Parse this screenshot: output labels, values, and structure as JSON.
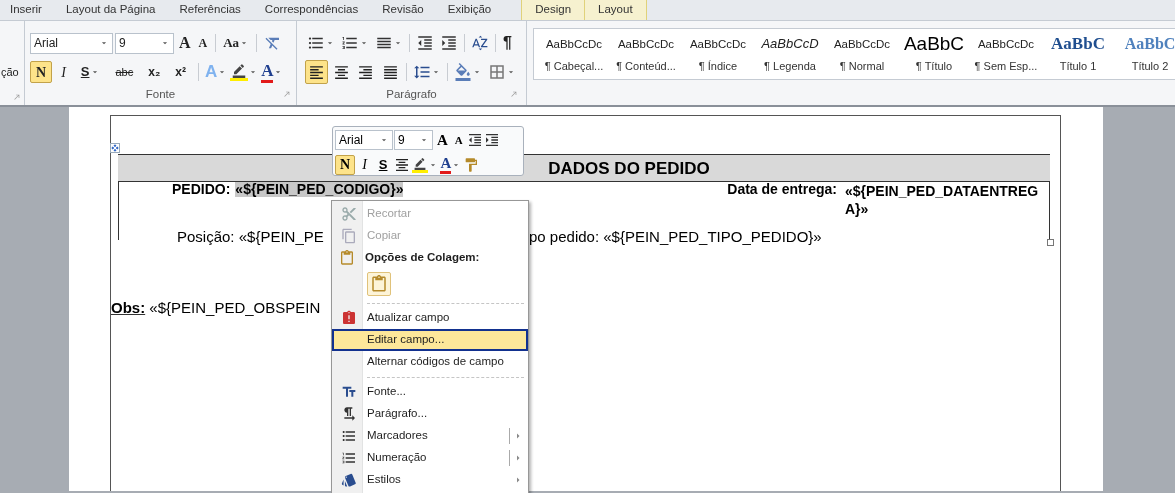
{
  "tabs": [
    {
      "label": "Inserir",
      "kind": "normal"
    },
    {
      "label": "Layout da Página",
      "kind": "normal"
    },
    {
      "label": "Referências",
      "kind": "normal"
    },
    {
      "label": "Correspondências",
      "kind": "normal"
    },
    {
      "label": "Revisão",
      "kind": "normal"
    },
    {
      "label": "Exibição",
      "kind": "normal"
    },
    {
      "label": "Design",
      "kind": "contextual"
    },
    {
      "label": "Layout",
      "kind": "contextual"
    }
  ],
  "ribbon": {
    "clipped_group_text": "ção",
    "font_group": {
      "label": "Fonte",
      "font_name": "Arial",
      "font_size": "9",
      "grow": "A",
      "shrink": "A",
      "change_case": "Aa",
      "format_buttons": [
        {
          "glyph": "N",
          "kind": "bold",
          "selected": true,
          "dropdown": false
        },
        {
          "glyph": "I",
          "kind": "italic",
          "selected": false,
          "dropdown": false
        },
        {
          "glyph": "S",
          "kind": "underline",
          "selected": false,
          "dropdown": true
        },
        {
          "glyph": "abc",
          "kind": "strike",
          "selected": false,
          "dropdown": false
        },
        {
          "glyph": "x₂",
          "kind": "sub",
          "selected": false,
          "dropdown": false
        },
        {
          "glyph": "x²",
          "kind": "sup",
          "selected": false,
          "dropdown": false
        }
      ],
      "effects": "A",
      "font_color": "A"
    },
    "paragraph_group": {
      "label": "Parágrafo",
      "pilcrow": "¶",
      "align_buttons": [
        {
          "kind": "left",
          "selected": true
        },
        {
          "kind": "center",
          "selected": false
        },
        {
          "kind": "right",
          "selected": false
        },
        {
          "kind": "justify",
          "selected": false
        }
      ]
    },
    "styles": [
      {
        "sample": "AaBbCcDc",
        "label": "¶ Cabeçal...",
        "kind": "plain"
      },
      {
        "sample": "AaBbCcDc",
        "label": "¶ Conteúd...",
        "kind": "plain"
      },
      {
        "sample": "AaBbCcDc",
        "label": "¶ Índice",
        "kind": "plain"
      },
      {
        "sample": "AaBbCcD",
        "label": "¶ Legenda",
        "kind": "italic"
      },
      {
        "sample": "AaBbCcDc",
        "label": "¶ Normal",
        "kind": "plain"
      },
      {
        "sample": "AaBbC",
        "label": "¶ Título",
        "kind": "title"
      },
      {
        "sample": "AaBbCcDc",
        "label": "¶ Sem Esp...",
        "kind": "plain"
      },
      {
        "sample": "AaBbC",
        "label": "Título 1",
        "kind": "heading1"
      },
      {
        "sample": "AaBbC",
        "label": "Título 2",
        "kind": "heading2"
      }
    ]
  },
  "document": {
    "table": {
      "title": "DADOS DO PEDIDO",
      "order_label": "PEDIDO:",
      "order_field": {
        "text": "«${PEIN_PED_CODIGO}»",
        "selected": true
      },
      "delivery_label": "Data de entrega:",
      "delivery_value": "«${PEIN_PED_DATAENTREGA}»",
      "position_text": "Posição: «${PEIN_PE",
      "type_text": "po pedido: «${PEIN_PED_TIPO_PEDIDO}»"
    },
    "obs_label": "Obs:",
    "obs_value": " «${PEIN_PED_OBSPEIN"
  },
  "mini_toolbar": {
    "font_name": "Arial",
    "font_size": "9",
    "grow": "A",
    "shrink": "A",
    "format_buttons": [
      {
        "glyph": "N",
        "kind": "bold",
        "selected": true
      },
      {
        "glyph": "I",
        "kind": "italic",
        "selected": false
      },
      {
        "glyph": "S",
        "kind": "underline",
        "selected": false
      }
    ],
    "font_color": "A"
  },
  "context_menu": [
    {
      "kind": "cut",
      "label": "Recortar",
      "disabled": true
    },
    {
      "kind": "copy",
      "label": "Copiar",
      "disabled": true
    },
    {
      "kind": "paste_header",
      "label": "Opções de Colagem:"
    },
    {
      "kind": "paste_button"
    },
    {
      "kind": "separator"
    },
    {
      "kind": "update",
      "label": "Atualizar campo",
      "disabled": false
    },
    {
      "kind": "plain",
      "label": "Editar campo...",
      "disabled": false,
      "selected": true
    },
    {
      "kind": "plain",
      "label": "Alternar códigos de campo",
      "disabled": false,
      "selected": false
    },
    {
      "kind": "separator"
    },
    {
      "kind": "font",
      "label": "Fonte...",
      "disabled": false
    },
    {
      "kind": "paragraph",
      "label": "Parágrafo...",
      "disabled": false
    },
    {
      "kind": "bullets",
      "label": "Marcadores",
      "disabled": false,
      "submenu": true,
      "split": true
    },
    {
      "kind": "numbering",
      "label": "Numeração",
      "disabled": false,
      "submenu": true,
      "split": true
    },
    {
      "kind": "styles",
      "label": "Estilos",
      "disabled": false,
      "submenu": true,
      "split": false
    }
  ]
}
